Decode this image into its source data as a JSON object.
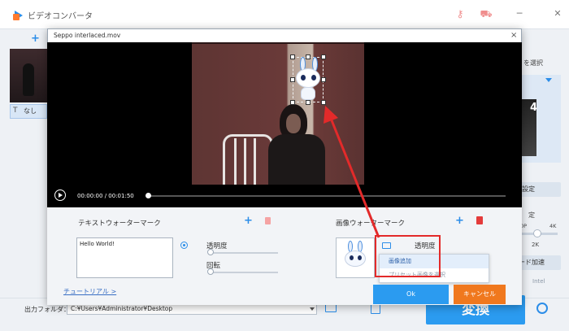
{
  "app": {
    "title": "ビデオコンバータ"
  },
  "left_panel": {
    "none_tab_label": "なし"
  },
  "right_panel": {
    "select_label": "を選択",
    "preview_number": "4",
    "settings_label": "設定",
    "fixed_label": "定",
    "res_low": "0P",
    "res_high": "4K",
    "res_value": "2K",
    "accel_label": "ード加速",
    "intel_label": "Intel"
  },
  "dialog": {
    "title": "Seppo interlaced.mov",
    "close_glyph": "×",
    "time_current": "00:00:00",
    "time_separator": "/",
    "time_total": "00:01:50",
    "text_watermark": {
      "title": "テキストウォーターマーク",
      "input_value": "Hello World!",
      "opacity_label": "透明度",
      "rotate_label": "回転"
    },
    "image_watermark": {
      "title": "画像ウォーターマーク",
      "opacity_label": "透明度",
      "menu": [
        "画像追加",
        "プリセット画像を選択"
      ]
    },
    "tutorial_link": "チュートリアル >",
    "ok_label": "Ok",
    "cancel_label": "キャンセル"
  },
  "bottom": {
    "output_label": "出力フォルダ：",
    "output_path": "C:¥Users¥Administrator¥Desktop",
    "convert_label": "変換"
  },
  "colors": {
    "accent": "#2b9bf0",
    "cancel": "#f0781e",
    "highlight": "#e32a2a"
  }
}
